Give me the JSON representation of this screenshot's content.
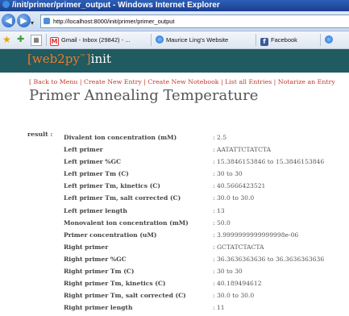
{
  "window": {
    "title": "/init/primer/primer_output - Windows Internet Explorer"
  },
  "nav": {
    "url": "http://localhost:8000/init/primer/primer_output",
    "back_glyph": "◀",
    "forward_glyph": "▶",
    "dropdown_glyph": "▾"
  },
  "favorites": {
    "grid_glyph": "▦",
    "tabs": [
      {
        "label": "Gmail - Inbox (29842) - ...",
        "icon": "gmail-icon"
      },
      {
        "label": "Maurice Ling's Website",
        "icon": "ie-page-icon"
      },
      {
        "label": "Facebook",
        "icon": "facebook-icon"
      }
    ]
  },
  "header": {
    "logo_brand": "[web2py",
    "logo_tm": "™",
    "logo_close": "]",
    "logo_app": "init"
  },
  "menu": {
    "open": "[",
    "items": [
      "Back to Menu",
      "Create New Entry",
      "Create New Notebook",
      "List all Entries",
      "Notarize an Entry"
    ],
    "sep": " | "
  },
  "page": {
    "title": "Primer Annealing Temperature"
  },
  "result": {
    "label": "result :",
    "rows": [
      {
        "key": "Divalent ion concentration (mM)",
        "value": ": 2.5"
      },
      {
        "key": "Left primer",
        "value": ": AATATTCTATCTA"
      },
      {
        "key": "Left primer %GC",
        "value": ": 15.3846153846 to 15.3846153846"
      },
      {
        "key": "Left primer Tm (C)",
        "value": ": 30 to 30"
      },
      {
        "key": "Left primer Tm, kinetics (C)",
        "value": ": 40.5666423521"
      },
      {
        "key": "Left primer Tm, salt corrected (C)",
        "value": ": 30.0 to 30.0"
      },
      {
        "key": "Left primer length",
        "value": ": 13"
      },
      {
        "key": "Monovalent ion concentration (mM)",
        "value": ": 50.0"
      },
      {
        "key": "Primer concentration (uM)",
        "value": ": 3.9999999999999998e-06"
      },
      {
        "key": "Right primer",
        "value": ": GCTATCTACTA"
      },
      {
        "key": "Right primer %GC",
        "value": ": 36.3636363636 to 36.3636363636"
      },
      {
        "key": "Right primer Tm (C)",
        "value": ": 30 to 30"
      },
      {
        "key": "Right primer Tm, kinetics (C)",
        "value": ": 40.189494612"
      },
      {
        "key": "Right primer Tm, salt corrected (C)",
        "value": ": 30.0 to 30.0"
      },
      {
        "key": "Right primer length",
        "value": ": 11"
      }
    ]
  }
}
